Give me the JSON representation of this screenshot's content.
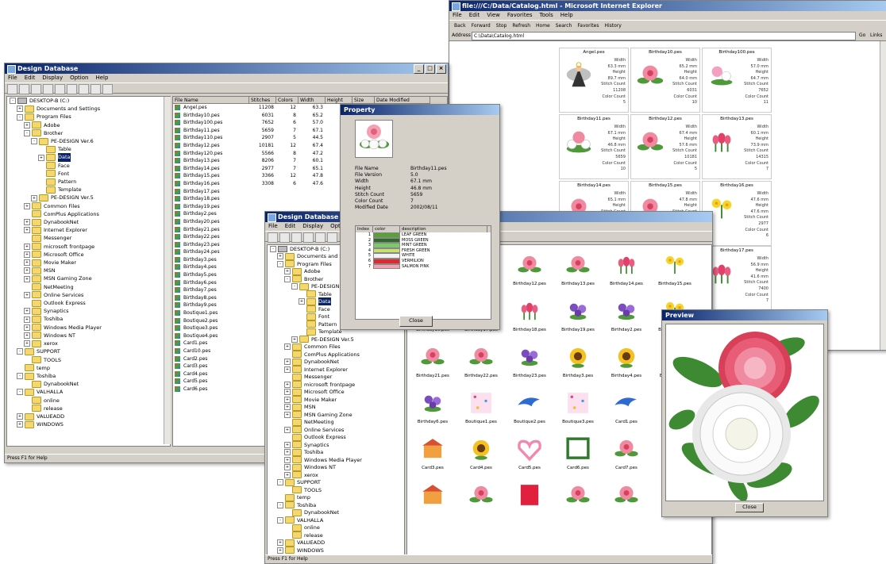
{
  "ie": {
    "title": "file:///C:/Data/Catalog.html - Microsoft Internet Explorer",
    "menu": [
      "File",
      "Edit",
      "View",
      "Favorites",
      "Tools",
      "Help"
    ],
    "nav": [
      "Back",
      "Forward",
      "Stop",
      "Refresh",
      "Home",
      "Search",
      "Favorites",
      "History"
    ],
    "address_label": "Address",
    "address_value": "C:\\Data\\Catalog.html",
    "go_label": "Go",
    "links_label": "Links",
    "info_labels": [
      "Width",
      "Height",
      "Stitch Count",
      "Color Count"
    ],
    "cards": [
      {
        "title": "Angel.pes",
        "width": "63.3 mm",
        "height": "89.7 mm",
        "stitches": "11208",
        "colors": "5",
        "art": "angel"
      },
      {
        "title": "Birthday10.pes",
        "width": "65.2 mm",
        "height": "64.0 mm",
        "stitches": "6031",
        "colors": "10",
        "art": "pink"
      },
      {
        "title": "Birthday100.pes",
        "width": "57.0 mm",
        "height": "64.7 mm",
        "stitches": "7652",
        "colors": "11",
        "art": "pinkwhite"
      },
      {
        "title": "Birthday11.pes",
        "width": "67.1 mm",
        "height": "46.8 mm",
        "stitches": "5659",
        "colors": "10",
        "art": "white"
      },
      {
        "title": "Birthday12.pes",
        "width": "67.4 mm",
        "height": "57.6 mm",
        "stitches": "10181",
        "colors": "5",
        "art": "pink"
      },
      {
        "title": "Birthday13.pes",
        "width": "60.1 mm",
        "height": "73.9 mm",
        "stitches": "14315",
        "colors": "7",
        "art": "tulip"
      },
      {
        "title": "Birthday14.pes",
        "width": "65.1 mm",
        "height": "",
        "stitches": "",
        "colors": "",
        "art": "pink"
      },
      {
        "title": "Birthday15.pes",
        "width": "47.8 mm",
        "height": "",
        "stitches": "",
        "colors": "",
        "art": "pink"
      },
      {
        "title": "Birthday16.pes",
        "width": "47.6 mm",
        "height": "47.6 mm",
        "stitches": "2977",
        "colors": "6",
        "art": "daffodil"
      },
      {
        "title": "Birthday17.pes",
        "width": "56.9 mm",
        "height": "41.6 mm",
        "stitches": "7400",
        "colors": "7",
        "art": "tulip"
      }
    ]
  },
  "dd": {
    "title": "Design Database",
    "menu": [
      "File",
      "Edit",
      "Display",
      "Option",
      "Help"
    ],
    "status": "Press F1 for Help",
    "tree": [
      {
        "label": "DESKTOP-B (C:)",
        "indent": 0,
        "pm": "-",
        "icon": "drive"
      },
      {
        "label": "Documents and Settings",
        "indent": 1,
        "pm": "+",
        "icon": "folder"
      },
      {
        "label": "Program Files",
        "indent": 1,
        "pm": "-",
        "icon": "folder"
      },
      {
        "label": "Adobe",
        "indent": 2,
        "pm": "+",
        "icon": "folder"
      },
      {
        "label": "Brother",
        "indent": 2,
        "pm": "-",
        "icon": "folder"
      },
      {
        "label": "PE-DESIGN Ver.6",
        "indent": 3,
        "pm": "-",
        "icon": "folder"
      },
      {
        "label": "Table",
        "indent": 4,
        "pm": "",
        "icon": "folder"
      },
      {
        "label": "Data",
        "indent": 4,
        "pm": "+",
        "icon": "folder",
        "selected": true
      },
      {
        "label": "Face",
        "indent": 4,
        "pm": "",
        "icon": "folder"
      },
      {
        "label": "Font",
        "indent": 4,
        "pm": "",
        "icon": "folder"
      },
      {
        "label": "Pattern",
        "indent": 4,
        "pm": "",
        "icon": "folder"
      },
      {
        "label": "Template",
        "indent": 4,
        "pm": "",
        "icon": "folder"
      },
      {
        "label": "PE-DESIGN Ver.5",
        "indent": 3,
        "pm": "+",
        "icon": "folder"
      },
      {
        "label": "Common Files",
        "indent": 2,
        "pm": "+",
        "icon": "folder"
      },
      {
        "label": "ComPlus Applications",
        "indent": 2,
        "pm": "",
        "icon": "folder"
      },
      {
        "label": "DynabookNet",
        "indent": 2,
        "pm": "+",
        "icon": "folder"
      },
      {
        "label": "Internet Explorer",
        "indent": 2,
        "pm": "+",
        "icon": "folder"
      },
      {
        "label": "Messenger",
        "indent": 2,
        "pm": "",
        "icon": "folder"
      },
      {
        "label": "microsoft frontpage",
        "indent": 2,
        "pm": "+",
        "icon": "folder"
      },
      {
        "label": "Microsoft Office",
        "indent": 2,
        "pm": "+",
        "icon": "folder"
      },
      {
        "label": "Movie Maker",
        "indent": 2,
        "pm": "+",
        "icon": "folder"
      },
      {
        "label": "MSN",
        "indent": 2,
        "pm": "+",
        "icon": "folder"
      },
      {
        "label": "MSN Gaming Zone",
        "indent": 2,
        "pm": "+",
        "icon": "folder"
      },
      {
        "label": "NetMeeting",
        "indent": 2,
        "pm": "",
        "icon": "folder"
      },
      {
        "label": "Online Services",
        "indent": 2,
        "pm": "+",
        "icon": "folder"
      },
      {
        "label": "Outlook Express",
        "indent": 2,
        "pm": "",
        "icon": "folder"
      },
      {
        "label": "Synaptics",
        "indent": 2,
        "pm": "+",
        "icon": "folder"
      },
      {
        "label": "Toshiba",
        "indent": 2,
        "pm": "+",
        "icon": "folder"
      },
      {
        "label": "Windows Media Player",
        "indent": 2,
        "pm": "+",
        "icon": "folder"
      },
      {
        "label": "Windows NT",
        "indent": 2,
        "pm": "+",
        "icon": "folder"
      },
      {
        "label": "xerox",
        "indent": 2,
        "pm": "+",
        "icon": "folder"
      },
      {
        "label": "SUPPORT",
        "indent": 1,
        "pm": "-",
        "icon": "folder"
      },
      {
        "label": "TOOLS",
        "indent": 2,
        "pm": "",
        "icon": "folder"
      },
      {
        "label": "temp",
        "indent": 1,
        "pm": "",
        "icon": "folder"
      },
      {
        "label": "Toshiba",
        "indent": 1,
        "pm": "-",
        "icon": "folder"
      },
      {
        "label": "DynabookNet",
        "indent": 2,
        "pm": "",
        "icon": "folder"
      },
      {
        "label": "VALHALLA",
        "indent": 1,
        "pm": "-",
        "icon": "folder"
      },
      {
        "label": "online",
        "indent": 2,
        "pm": "",
        "icon": "folder"
      },
      {
        "label": "release",
        "indent": 2,
        "pm": "",
        "icon": "folder"
      },
      {
        "label": "VALUEADD",
        "indent": 1,
        "pm": "+",
        "icon": "folder"
      },
      {
        "label": "WINDOWS",
        "indent": 1,
        "pm": "+",
        "icon": "folder"
      }
    ],
    "columns": [
      "File Name",
      "Stitches",
      "Colors",
      "Width",
      "Height",
      "Size",
      "Date Modified"
    ],
    "files": [
      {
        "name": "Angel.pes",
        "stitches": "11208",
        "colors": "12",
        "width": "63.3",
        "height": "89.7"
      },
      {
        "name": "Birthday10.pes",
        "stitches": "6031",
        "colors": "8",
        "width": "65.2",
        "height": "64.0"
      },
      {
        "name": "Birthday100.pes",
        "stitches": "7652",
        "colors": "6",
        "width": "57.0",
        "height": "64.7"
      },
      {
        "name": "Birthday11.pes",
        "stitches": "5659",
        "colors": "7",
        "width": "67.1",
        "height": "46.8"
      },
      {
        "name": "Birthday110.pes",
        "stitches": "2907",
        "colors": "5",
        "width": "44.5",
        "height": "45.9"
      },
      {
        "name": "Birthday12.pes",
        "stitches": "10181",
        "colors": "12",
        "width": "67.4",
        "height": "57.6"
      },
      {
        "name": "Birthday120.pes",
        "stitches": "5566",
        "colors": "8",
        "width": "47.2",
        "height": "44.7"
      },
      {
        "name": "Birthday13.pes",
        "stitches": "8206",
        "colors": "7",
        "width": "60.1",
        "height": "73.9"
      },
      {
        "name": "Birthday14.pes",
        "stitches": "2977",
        "colors": "7",
        "width": "65.1",
        "height": "43.8"
      },
      {
        "name": "Birthday15.pes",
        "stitches": "3366",
        "colors": "12",
        "width": "47.8",
        "height": "45.0"
      },
      {
        "name": "Birthday16.pes",
        "stitches": "3308",
        "colors": "6",
        "width": "47.6",
        "height": "47.6"
      }
    ],
    "more_files": [
      "Birthday17.pes",
      "Birthday18.pes",
      "Birthday19.pes",
      "Birthday2.pes",
      "Birthday20.pes",
      "Birthday21.pes",
      "Birthday22.pes",
      "Birthday23.pes",
      "Birthday24.pes",
      "Birthday3.pes",
      "Birthday4.pes",
      "Birthday5.pes",
      "Birthday6.pes",
      "Birthday7.pes",
      "Birthday8.pes",
      "Birthday9.pes",
      "Boutique1.pes",
      "Boutique2.pes",
      "Boutique3.pes",
      "Boutique4.pes",
      "Card1.pes",
      "Card10.pes",
      "Card2.pes",
      "Card3.pes",
      "Card4.pes",
      "Card5.pes",
      "Card6.pes"
    ]
  },
  "dd2": {
    "title": "Design Database",
    "menu": [
      "File",
      "Edit",
      "Display",
      "Option"
    ],
    "status": "Press F1 for Help",
    "grid_captions": [
      "Birthday10.pes",
      "Birthday11.pes",
      "Birthday12.pes",
      "Birthday13.pes",
      "Birthday14.pes",
      "Birthday15.pes",
      "Birthday16.pes",
      "Birthday17.pes",
      "Birthday18.pes",
      "Birthday19.pes",
      "Birthday2.pes",
      "Birthday20.pes",
      "Birthday21.pes",
      "Birthday22.pes",
      "Birthday23.pes",
      "Birthday3.pes",
      "Birthday4.pes",
      "Birthday5.pes",
      "Birthday6.pes",
      "Boutique1.pes",
      "Boutique2.pes",
      "Boutique3.pes",
      "Card1.pes",
      "Card2.pes",
      "Card3.pes",
      "Card4.pes",
      "Card5.pes",
      "Card6.pes",
      "Card7.pes",
      "Card8.pes",
      "",
      "",
      "",
      "",
      ""
    ]
  },
  "prop": {
    "title": "Property",
    "keys": [
      "File Name",
      "File Version",
      "Width",
      "Height",
      "Stitch Count",
      "Color Count",
      "Modified Date"
    ],
    "values": [
      "Birthday11.pes",
      "5.0",
      "67.1      mm",
      "46.8      mm",
      "5659",
      "7",
      "2002/08/11"
    ],
    "table_headers": [
      "Index",
      "color",
      "description"
    ],
    "colors": [
      {
        "index": "1",
        "hex": "#5aa03a",
        "desc": "LEAF GREEN"
      },
      {
        "index": "2",
        "hex": "#2e6b2a",
        "desc": "MOSS GREEN"
      },
      {
        "index": "3",
        "hex": "#7cc86a",
        "desc": "MINT GREEN"
      },
      {
        "index": "4",
        "hex": "#c8e070",
        "desc": "FRESH GREEN"
      },
      {
        "index": "5",
        "hex": "#f2f2f2",
        "desc": "WHITE"
      },
      {
        "index": "6",
        "hex": "#e02830",
        "desc": "VERMILION"
      },
      {
        "index": "7",
        "hex": "#f4a0b0",
        "desc": "SALMON PINK"
      }
    ],
    "close": "Close"
  },
  "preview": {
    "title": "Preview",
    "close": "Close"
  }
}
